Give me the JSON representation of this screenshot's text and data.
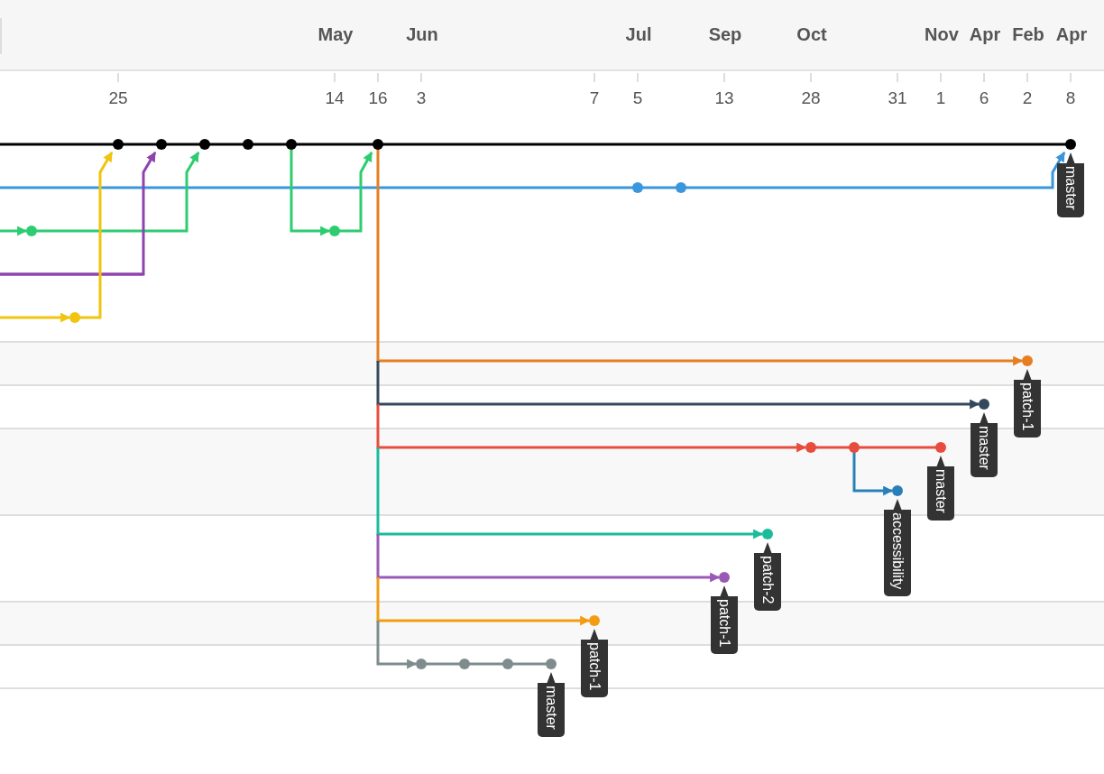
{
  "timeline": {
    "columns": [
      {},
      {},
      {
        "day": "25"
      },
      {},
      {},
      {},
      {},
      {
        "month": "May",
        "day": "14"
      },
      {
        "day": "16"
      },
      {
        "month": "Jun",
        "day": "3"
      },
      {},
      {},
      {},
      {
        "day": "7"
      },
      {
        "month": "Jul",
        "day": "5"
      },
      {},
      {
        "month": "Sep",
        "day": "13"
      },
      {},
      {
        "month": "Oct",
        "day": "28"
      },
      {},
      {
        "day": "31"
      },
      {
        "month": "Nov",
        "day": "1"
      },
      {
        "month": "Apr",
        "day": "6"
      },
      {
        "month": "Feb",
        "day": "2"
      },
      {
        "month": "Apr",
        "day": "8"
      }
    ]
  },
  "lanes": [
    {
      "color": "#000000",
      "tag": "master"
    },
    {
      "color": "#3a96dd"
    },
    {
      "color": "#2ecc71"
    },
    {
      "color": "#2ecc71"
    },
    {
      "color": "#8e44ad"
    },
    {
      "color": "#f1c40f"
    },
    {
      "color": "#e67e22",
      "tag": "patch-1"
    },
    {
      "color": "#34495e",
      "tag": "master"
    },
    {
      "color": "#e74c3c",
      "tag": "master"
    },
    {
      "color": "#2980b9",
      "tag": "accessibility"
    },
    {
      "color": "#1abc9c",
      "tag": "patch-2"
    },
    {
      "color": "#9b59b6",
      "tag": "patch-1"
    },
    {
      "color": "#f39c12",
      "tag": "patch-1"
    },
    {
      "color": "#7f8c8d",
      "tag": "master"
    }
  ]
}
